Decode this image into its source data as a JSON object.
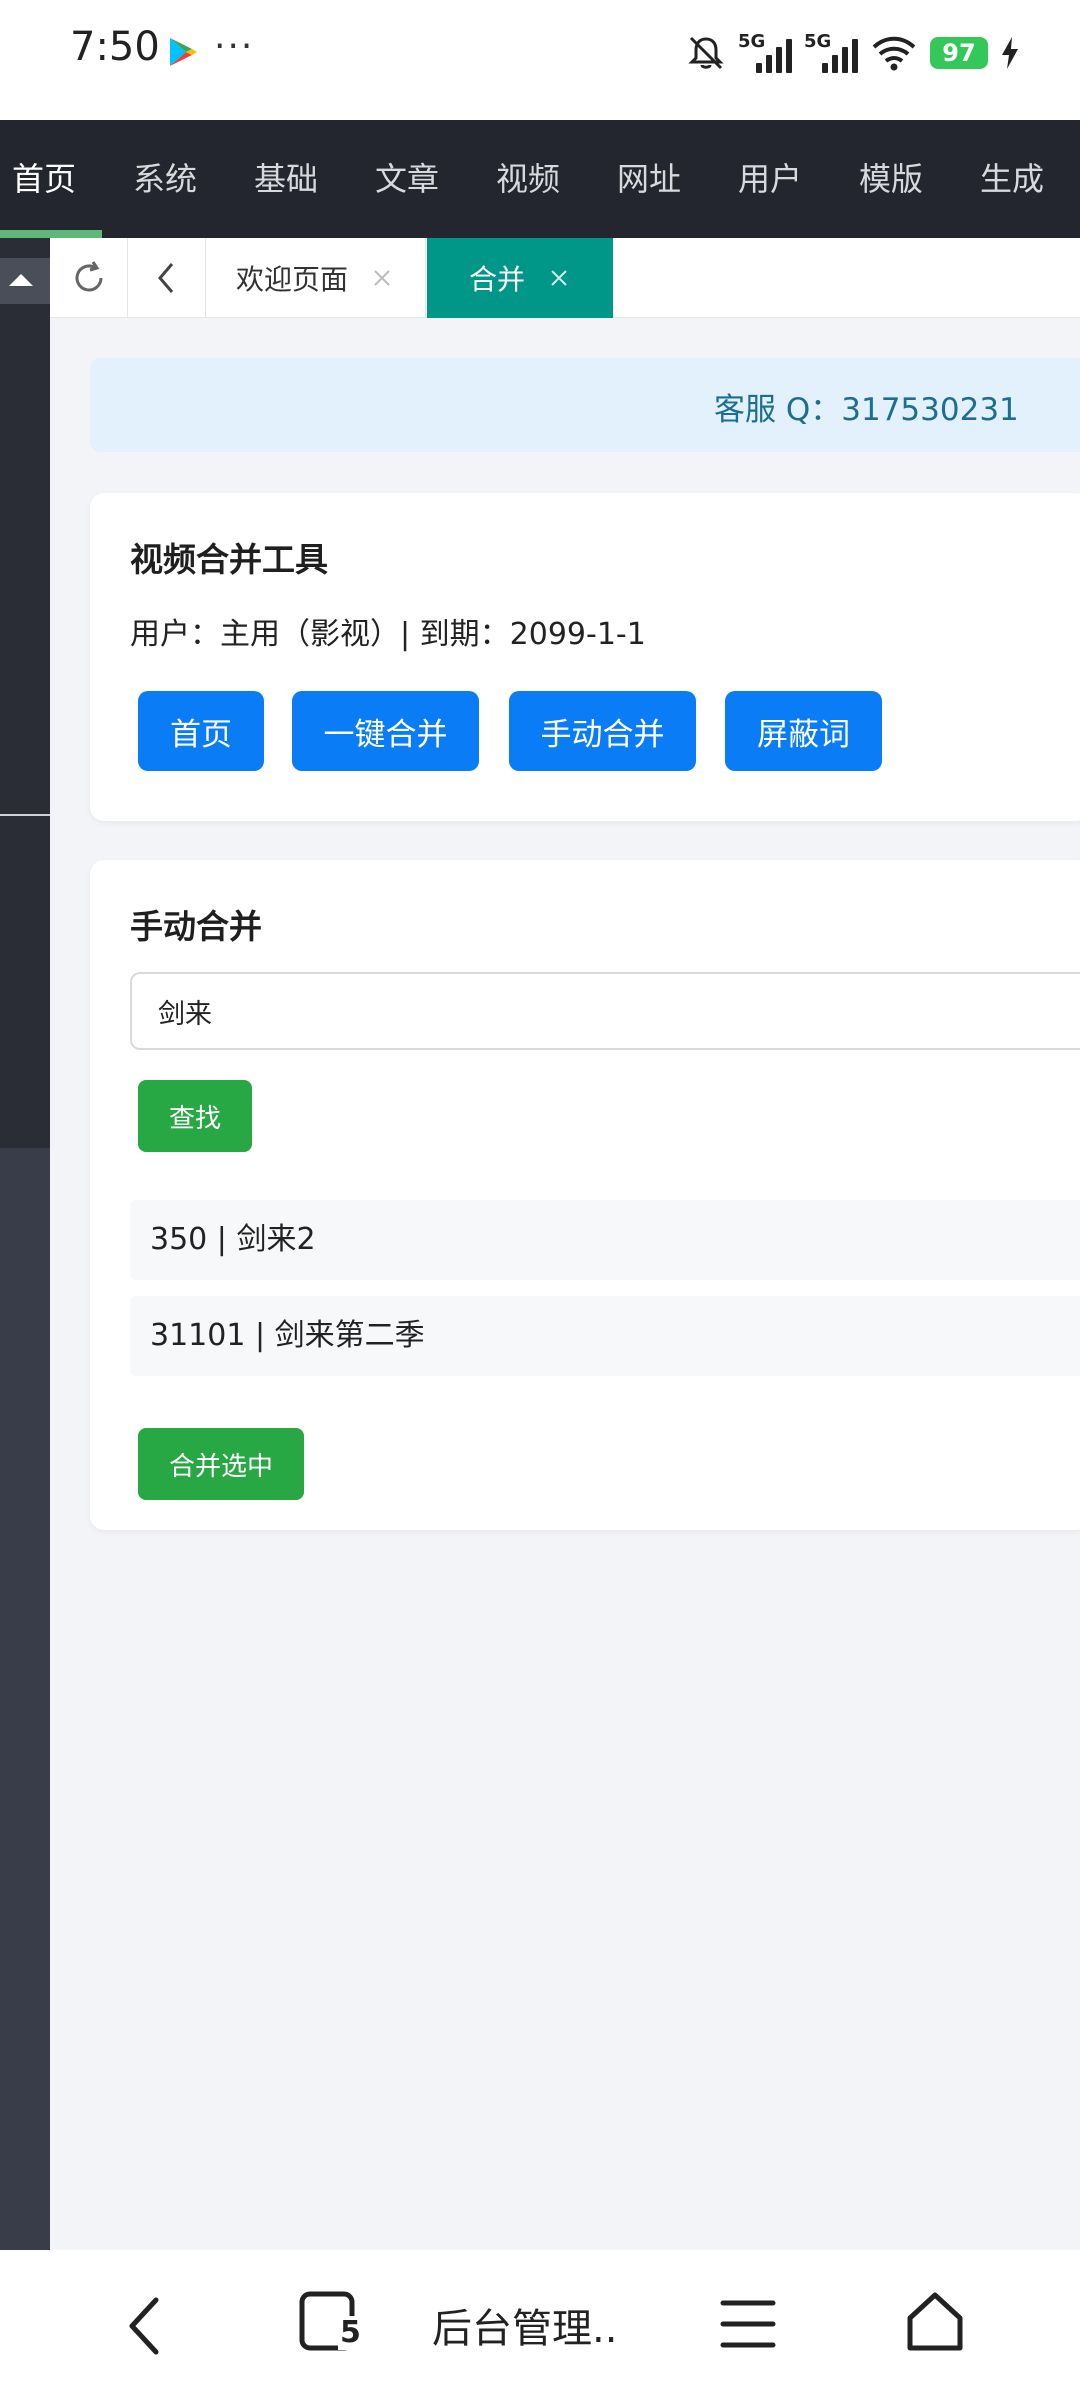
{
  "status_bar": {
    "time": "7:50",
    "dots": "···",
    "signal1_label": "5G",
    "signal2_label": "5G",
    "battery": "97"
  },
  "top_nav": {
    "items": [
      "首页",
      "系统",
      "基础",
      "文章",
      "视频",
      "网址",
      "用户",
      "模版",
      "生成"
    ],
    "active_index": 0
  },
  "tabs": {
    "welcome_label": "欢迎页面",
    "active_label": "合并"
  },
  "notice": {
    "text": "客服 Q：317530231"
  },
  "tool_card": {
    "title": "视频合并工具",
    "user_line": "用户：主用（影视）| 到期：2099-1-1",
    "buttons": [
      "首页",
      "一键合并",
      "手动合并",
      "屏蔽词"
    ]
  },
  "manual_card": {
    "title": "手动合并",
    "search_value": "剑来",
    "search_button": "查找",
    "results": [
      "350 | 剑来2",
      "31101 | 剑来第二季"
    ],
    "merge_button": "合并选中"
  },
  "bottom_bar": {
    "tab_count": "5",
    "page_title": "后台管理.."
  },
  "colors": {
    "nav_bg": "#23262e",
    "nav_active_underline": "#5fb878",
    "tab_active": "#009688",
    "primary_blue": "#0a7cf5",
    "success_green": "#28a745",
    "notice_bg": "#e3f1fc",
    "notice_text": "#1c6f93"
  },
  "icons": [
    "play-store-icon",
    "mute-bell-icon",
    "wifi-icon",
    "charging-bolt-icon",
    "refresh-icon",
    "chevron-left-icon",
    "close-icon",
    "back-arrow-icon",
    "tabs-icon",
    "menu-icon",
    "home-icon"
  ]
}
